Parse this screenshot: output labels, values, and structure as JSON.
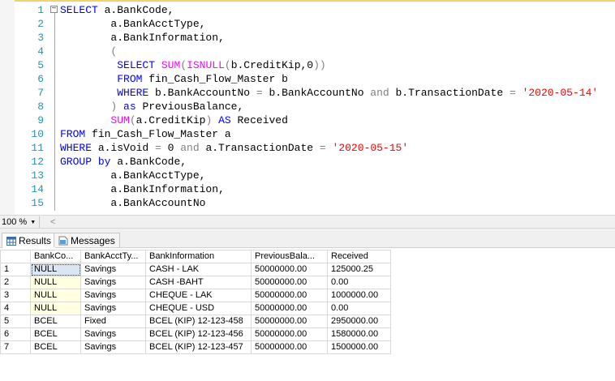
{
  "editor": {
    "lines": [
      {
        "num": "1",
        "tokens": [
          {
            "t": "SELECT",
            "c": "kw"
          },
          {
            "t": " a.BankCode,",
            "c": ""
          }
        ]
      },
      {
        "num": "2",
        "tokens": [
          {
            "t": "        a.BankAcctType,",
            "c": ""
          }
        ]
      },
      {
        "num": "3",
        "tokens": [
          {
            "t": "        a.BankInformation,",
            "c": ""
          }
        ]
      },
      {
        "num": "4",
        "tokens": [
          {
            "t": "        (",
            "c": "op"
          }
        ]
      },
      {
        "num": "5",
        "tokens": [
          {
            "t": "         ",
            "c": ""
          },
          {
            "t": "SELECT",
            "c": "kw"
          },
          {
            "t": " ",
            "c": ""
          },
          {
            "t": "SUM",
            "c": "fn"
          },
          {
            "t": "(",
            "c": "op"
          },
          {
            "t": "ISNULL",
            "c": "fn"
          },
          {
            "t": "(",
            "c": "op"
          },
          {
            "t": "b.CreditKip,0",
            "c": ""
          },
          {
            "t": "))",
            "c": "op"
          }
        ]
      },
      {
        "num": "6",
        "tokens": [
          {
            "t": "         ",
            "c": ""
          },
          {
            "t": "FROM",
            "c": "kw"
          },
          {
            "t": " fin_Cash_Flow_Master b",
            "c": ""
          }
        ]
      },
      {
        "num": "7",
        "tokens": [
          {
            "t": "         ",
            "c": ""
          },
          {
            "t": "WHERE",
            "c": "kw"
          },
          {
            "t": " b.BankAccountNo ",
            "c": ""
          },
          {
            "t": "=",
            "c": "op"
          },
          {
            "t": " b.BankAccountNo ",
            "c": ""
          },
          {
            "t": "and",
            "c": "op"
          },
          {
            "t": " b.TransactionDate ",
            "c": ""
          },
          {
            "t": "=",
            "c": "op"
          },
          {
            "t": " ",
            "c": ""
          },
          {
            "t": "'2020-05-14'",
            "c": "str"
          }
        ]
      },
      {
        "num": "8",
        "tokens": [
          {
            "t": "        ",
            "c": ""
          },
          {
            "t": ")",
            "c": "op"
          },
          {
            "t": " ",
            "c": ""
          },
          {
            "t": "as",
            "c": "kw"
          },
          {
            "t": " PreviousBalance,",
            "c": ""
          }
        ]
      },
      {
        "num": "9",
        "tokens": [
          {
            "t": "        ",
            "c": ""
          },
          {
            "t": "SUM",
            "c": "fn"
          },
          {
            "t": "(",
            "c": "op"
          },
          {
            "t": "a.CreditKip",
            "c": ""
          },
          {
            "t": ")",
            "c": "op"
          },
          {
            "t": " ",
            "c": ""
          },
          {
            "t": "AS",
            "c": "kw"
          },
          {
            "t": " Received",
            "c": ""
          }
        ]
      },
      {
        "num": "10",
        "tokens": [
          {
            "t": "FROM",
            "c": "kw"
          },
          {
            "t": " fin_Cash_Flow_Master a",
            "c": ""
          }
        ]
      },
      {
        "num": "11",
        "tokens": [
          {
            "t": "WHERE",
            "c": "kw"
          },
          {
            "t": " a.isVoid ",
            "c": ""
          },
          {
            "t": "=",
            "c": "op"
          },
          {
            "t": " 0 ",
            "c": ""
          },
          {
            "t": "and",
            "c": "op"
          },
          {
            "t": " a.TransactionDate ",
            "c": ""
          },
          {
            "t": "=",
            "c": "op"
          },
          {
            "t": " ",
            "c": ""
          },
          {
            "t": "'2020-05-15'",
            "c": "str"
          }
        ]
      },
      {
        "num": "12",
        "tokens": [
          {
            "t": "GROUP",
            "c": "kw"
          },
          {
            "t": " ",
            "c": ""
          },
          {
            "t": "by",
            "c": "kw"
          },
          {
            "t": " a.BankCode,",
            "c": ""
          }
        ]
      },
      {
        "num": "13",
        "tokens": [
          {
            "t": "        a.BankAcctType,",
            "c": ""
          }
        ]
      },
      {
        "num": "14",
        "tokens": [
          {
            "t": "        a.BankInformation,",
            "c": ""
          }
        ]
      },
      {
        "num": "15",
        "tokens": [
          {
            "t": "        a.BankAccountNo",
            "c": ""
          }
        ]
      }
    ]
  },
  "zoom": {
    "label": "100 %",
    "scroll_left": "<"
  },
  "tabs": {
    "results": "Results",
    "messages": "Messages"
  },
  "grid": {
    "columns": [
      "",
      "BankCo...",
      "BankAcctTy...",
      "BankInformation",
      "PreviousBala...",
      "Received"
    ],
    "rows": [
      [
        "1",
        "NULL",
        "Savings",
        "CASH - LAK",
        "50000000.00",
        "125000.25"
      ],
      [
        "2",
        "NULL",
        "Savings",
        "CASH -BAHT",
        "50000000.00",
        "0.00"
      ],
      [
        "3",
        "NULL",
        "Savings",
        "CHEQUE - LAK",
        "50000000.00",
        "1000000.00"
      ],
      [
        "4",
        "NULL",
        "Savings",
        "CHEQUE - USD",
        "50000000.00",
        "0.00"
      ],
      [
        "5",
        "BCEL",
        "Fixed",
        "BCEL (KIP) 12-123-458",
        "50000000.00",
        "2950000.00"
      ],
      [
        "6",
        "BCEL",
        "Savings",
        "BCEL (KIP) 12-123-456",
        "50000000.00",
        "1580000.00"
      ],
      [
        "7",
        "BCEL",
        "Savings",
        "BCEL (KIP) 12-123-457",
        "50000000.00",
        "1500000.00"
      ]
    ]
  }
}
